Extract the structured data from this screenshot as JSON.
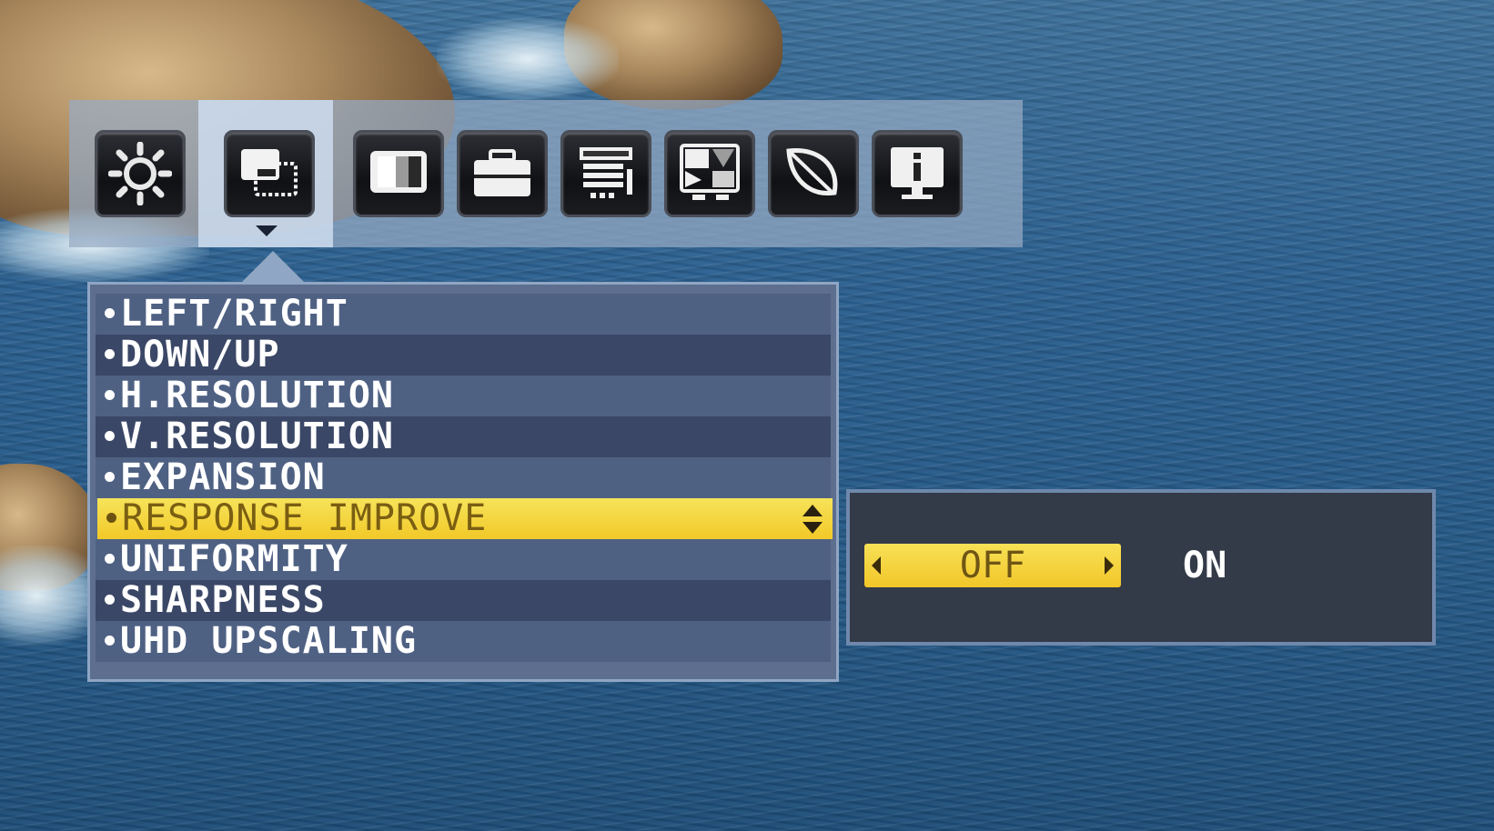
{
  "icon_bar": {
    "selected_index": 1,
    "icons": [
      {
        "name": "brightness-icon"
      },
      {
        "name": "picture-position-icon"
      },
      {
        "name": "color-icon"
      },
      {
        "name": "toolbox-icon"
      },
      {
        "name": "tools-menu-icon"
      },
      {
        "name": "picture-in-picture-icon"
      },
      {
        "name": "eco-leaf-icon"
      },
      {
        "name": "information-icon"
      }
    ]
  },
  "menu": {
    "selected_index": 5,
    "items": [
      {
        "label": "LEFT/RIGHT"
      },
      {
        "label": "DOWN/UP"
      },
      {
        "label": "H.RESOLUTION"
      },
      {
        "label": "V.RESOLUTION"
      },
      {
        "label": "EXPANSION"
      },
      {
        "label": "RESPONSE IMPROVE"
      },
      {
        "label": "UNIFORMITY"
      },
      {
        "label": "SHARPNESS"
      },
      {
        "label": "UHD UPSCALING"
      }
    ]
  },
  "submenu": {
    "options": [
      {
        "label": "OFF",
        "selected": true
      },
      {
        "label": "ON",
        "selected": false
      }
    ]
  },
  "colors": {
    "highlight": "#f4d43a",
    "panel": "#5d6e8f",
    "sub_panel": "#333a48"
  }
}
